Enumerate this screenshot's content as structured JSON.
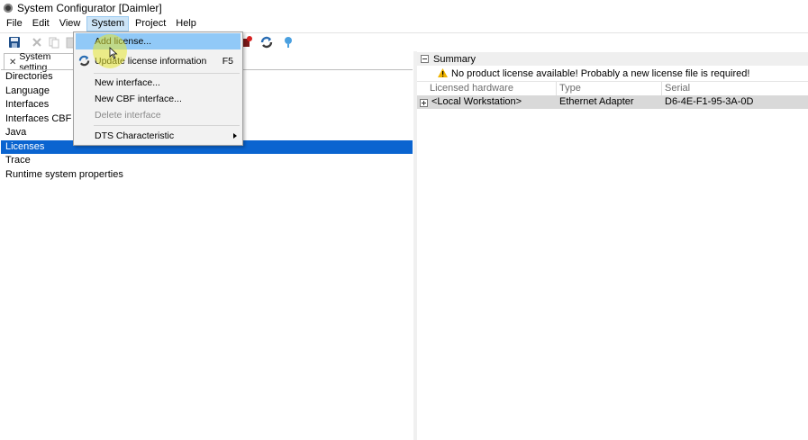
{
  "window": {
    "title": "System Configurator [Daimler]"
  },
  "menubar": {
    "items": [
      "File",
      "Edit",
      "View",
      "System",
      "Project",
      "Help"
    ],
    "active": "System"
  },
  "toolbar": {
    "icons": [
      "save-icon",
      "delete-icon",
      "copy-icon",
      "paste-icon",
      "stop-icon",
      "refresh-icon",
      "help-icon"
    ]
  },
  "system_menu": {
    "items": [
      {
        "label": "Add license...",
        "shortcut": "",
        "state": "hover"
      },
      {
        "label": "Update license information",
        "shortcut": "F5",
        "state": "normal",
        "icon": "refresh-icon"
      },
      {
        "label": "New interface...",
        "shortcut": "",
        "state": "normal"
      },
      {
        "label": "New CBF interface...",
        "shortcut": "",
        "state": "normal"
      },
      {
        "label": "Delete interface",
        "shortcut": "",
        "state": "disabled"
      },
      {
        "label": "DTS Characteristic",
        "shortcut": "",
        "state": "submenu"
      }
    ]
  },
  "left_panel": {
    "tab_label": "System setting",
    "items": [
      "Directories",
      "Language",
      "Interfaces",
      "Interfaces CBF",
      "Java",
      "Licenses",
      "Trace",
      "Runtime system properties"
    ],
    "selected": "Licenses"
  },
  "right_panel": {
    "section_title": "Summary",
    "warning": "No product license available! Probably a new license file is required!",
    "columns": [
      "Licensed hardware",
      "Type",
      "Serial"
    ],
    "rows": [
      {
        "hardware": "<Local Workstation>",
        "type": "Ethernet Adapter",
        "serial": "D6-4E-F1-95-3A-0D"
      }
    ]
  },
  "colors": {
    "selection": "#0a64d0",
    "menu_hover": "#91c9f7",
    "warning": "#f0b400"
  }
}
